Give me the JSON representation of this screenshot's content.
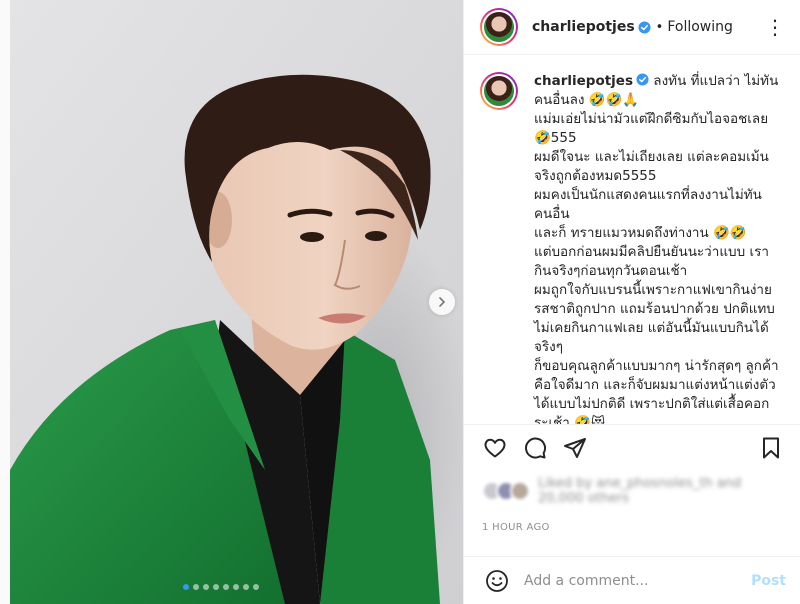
{
  "post": {
    "username": "charliepotjes",
    "follow_status": "Following",
    "separator": "•",
    "more_icon": "more-horizontal-icon",
    "carousel": {
      "slides": 8,
      "active_index": 0
    }
  },
  "caption": {
    "username": "charliepotjes",
    "lines": [
      " ลงทัน ที่แปลว่า ไม่ทัน",
      "คนอื่นลง 🤣🤣🙏",
      "แม่มเอ่ยไม่น่ามัวแต่ฝึกดีซิมกับไอจอชเลย",
      "🤣555",
      "ผมดีใจนะ และไม่เถียงเลย แต่ละคอมเม้น",
      "จริงถูกต้องหมด5555",
      "ผมคงเป็นนักแสดงคนแรกที่ลงงานไม่ทัน",
      "คนอื่น",
      "และก็ ทรายแมวหมดถึงท่างาน 🤣🤣",
      "แต่บอกก่อนผมมีคลิปยืนยันนะว่าแบบ เรา",
      "กินจริงๆก่อนทุกวันตอนเช้า",
      "ผมถูกใจกับแบรนนี้เพราะกาแฟเขากินง่าย",
      "รสชาติถูกปาก แถมร้อนปากด้วย ปกติแทบ",
      "ไม่เคยกินกาแฟเลย แต่อันนี้มันแบบกินได้",
      "จริงๆ",
      "ก็ขอบคุณลูกค้าแบบมากๆ น่ารักสุดๆ ลูกค้า",
      "คือใจดีมาก และก็จับผมมาแต่งหน้าแต่งตัว",
      "ได้แบบไม่ปกติดี เพราะปกติใส่แต่เสื้อคอก",
      "ระเช้า 🤣😻"
    ]
  },
  "likes": {
    "text_line1": "Liked by ane_phosnoles_th and",
    "text_line2": "20,000 others"
  },
  "timestamp": "1 HOUR AGO",
  "comment": {
    "placeholder": "Add a comment...",
    "post_label": "Post"
  },
  "colors": {
    "accent": "#3897f0",
    "post_disabled": "#b2dffc",
    "text": "#262626",
    "muted": "#8e8e8e",
    "jacket_green": "#1f8a3e"
  }
}
